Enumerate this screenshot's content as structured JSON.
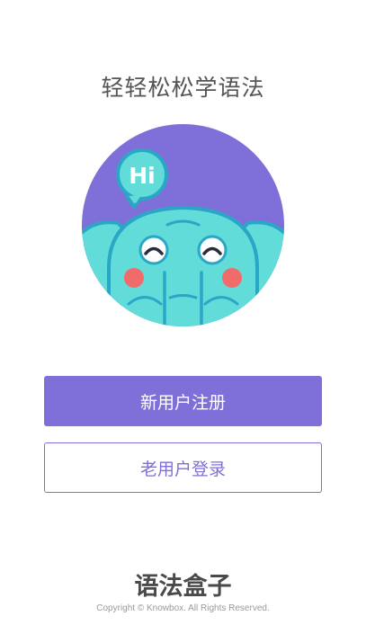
{
  "header": {
    "slogan": "轻轻松松学语法"
  },
  "mascot": {
    "speech_bubble_text": "Hi",
    "icon": "elephant-mascot-icon"
  },
  "actions": {
    "register_label": "新用户注册",
    "login_label": "老用户登录"
  },
  "footer": {
    "brand_name": "语法盒子",
    "copyright": "Copyright © Knowbox. All Rights Reserved."
  },
  "colors": {
    "accent": "#7f6fd8",
    "mascot_body": "#62dcd9",
    "mascot_outline": "#2aa6c7",
    "cheek": "#f26b6b",
    "text_dark": "#555555"
  }
}
